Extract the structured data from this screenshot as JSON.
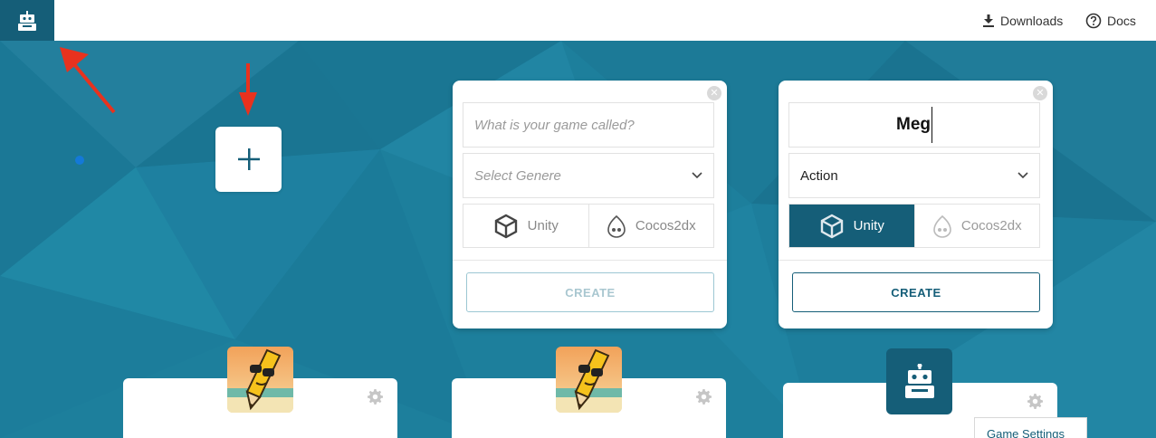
{
  "topbar": {
    "logo_icon": "robot-icon",
    "downloads_label": "Downloads",
    "docs_label": "Docs"
  },
  "new_game": {
    "icon": "plus-icon"
  },
  "form_empty": {
    "name_placeholder": "What is your game called?",
    "genre_placeholder": "Select Genere",
    "engines": [
      "Unity",
      "Cocos2dx"
    ],
    "create_label": "CREATE"
  },
  "form_filled": {
    "name_value": "Meg",
    "genre_value": "Action",
    "engines": [
      "Unity",
      "Cocos2dx"
    ],
    "selected_engine": "Unity",
    "create_label": "CREATE"
  },
  "context_menu": {
    "item": "Game Settings"
  },
  "colors": {
    "brand": "#155e78",
    "background": "#1d7f9c",
    "annotation_arrow": "#e8321e"
  }
}
